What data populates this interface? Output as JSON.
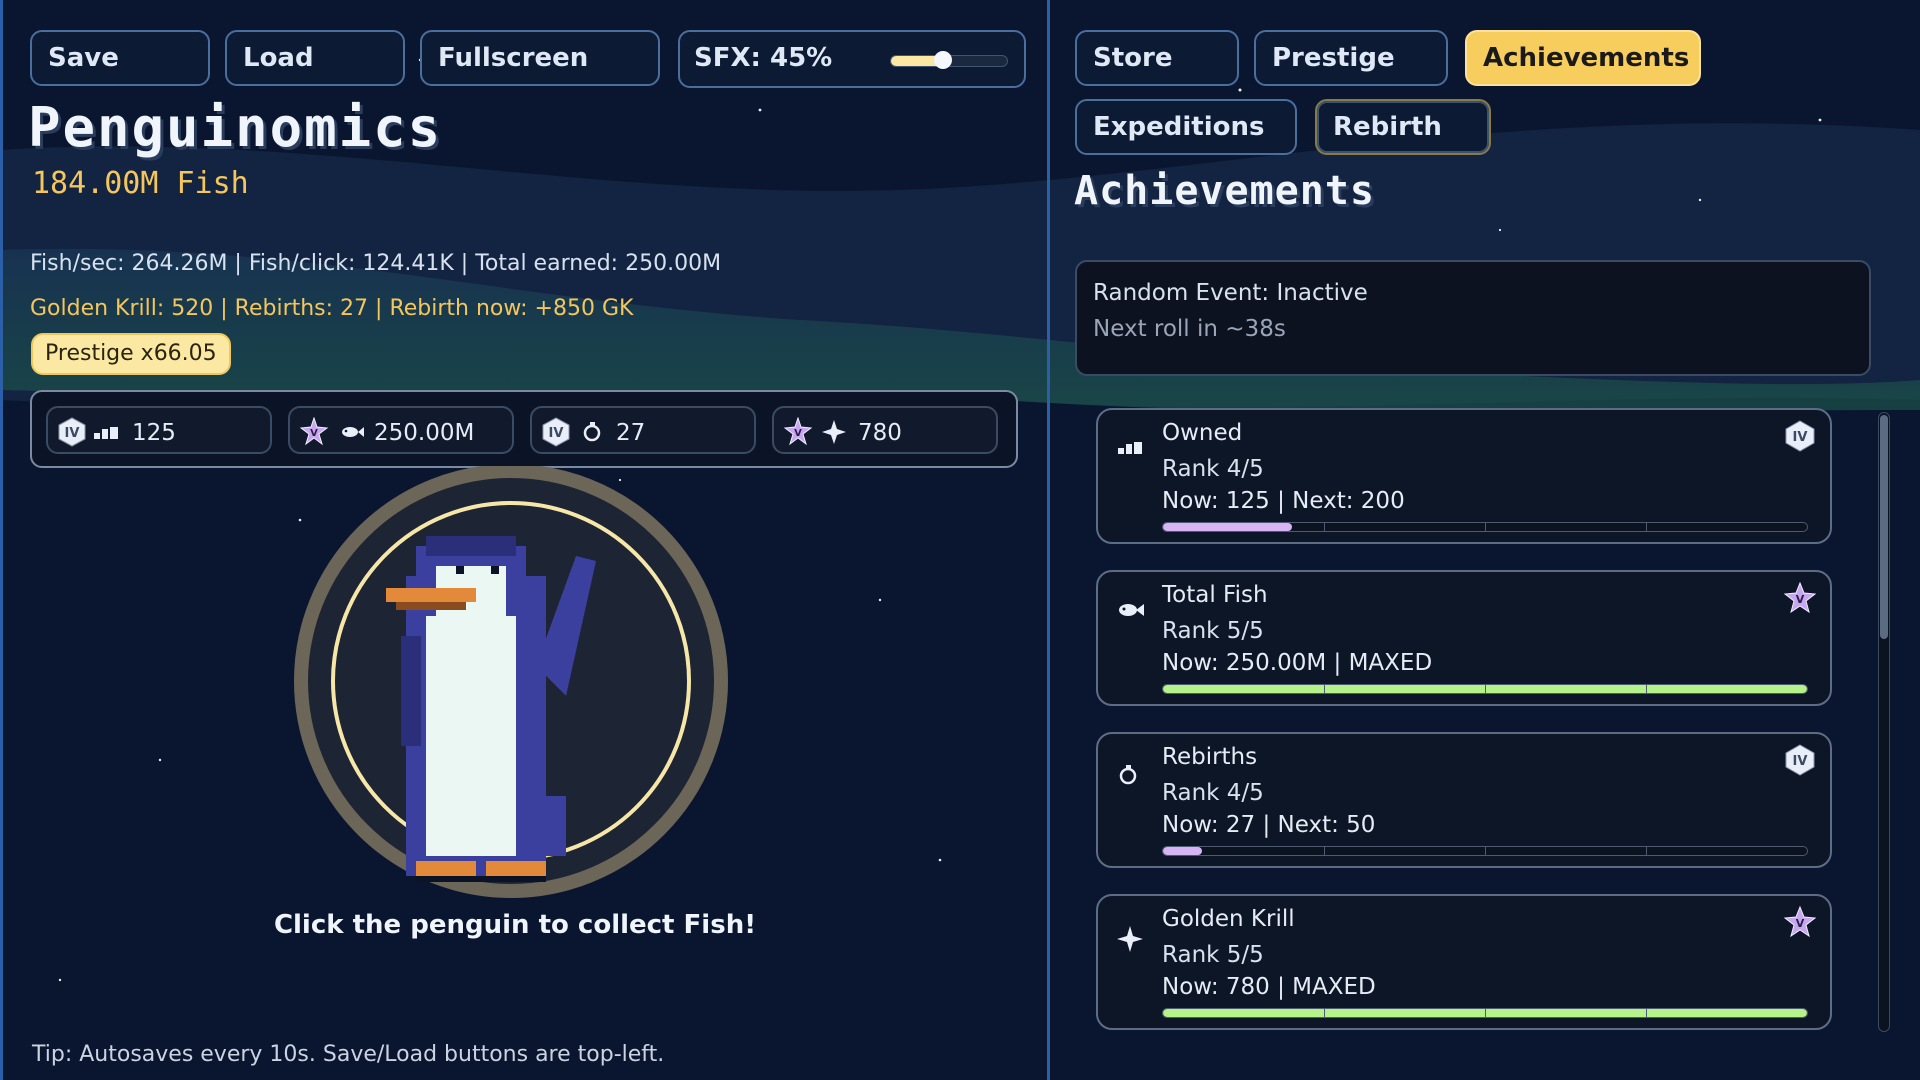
{
  "toolbar": {
    "save_label": "Save",
    "load_label": "Load",
    "fullscreen_label": "Fullscreen",
    "sfx_label": "SFX:  45%",
    "sfx_value": 0.45
  },
  "game": {
    "title": "Penguinomics",
    "fish_count": "184.00M Fish",
    "stats_line1": "Fish/sec: 264.26M  |  Fish/click: 124.41K  |  Total earned: 250.00M",
    "stats_line2": "Golden Krill: 520  |  Rebirths: 27  |  Rebirth now: +850 GK",
    "prestige_pill": "Prestige x66.05",
    "click_hint": "Click the penguin to collect Fish!",
    "tip": "Tip: Autosaves every 10s. Save/Load buttons are top-left."
  },
  "achievement_chips": [
    {
      "tier_icon": "tier-iv-badge",
      "icon": "owned-icon",
      "value": "125"
    },
    {
      "tier_icon": "tier-v-star",
      "icon": "fish-icon",
      "value": "250.00M"
    },
    {
      "tier_icon": "tier-iv-badge",
      "icon": "rebirth-icon",
      "value": "27"
    },
    {
      "tier_icon": "tier-v-star",
      "icon": "sparkle-icon",
      "value": "780"
    }
  ],
  "tabs": {
    "store": "Store",
    "prestige": "Prestige",
    "achievements": "Achievements",
    "expeditions": "Expeditions",
    "rebirth": "Rebirth",
    "active": "achievements"
  },
  "section_title": "Achievements",
  "random_event": {
    "status": "Random Event: Inactive",
    "next_roll": "Next roll in ~38s"
  },
  "achievements": [
    {
      "name": "Owned",
      "rank": "Rank 4/5",
      "progress_text": "Now: 125  |  Next: 200",
      "progress": 0.2,
      "color": "#d8b4f5",
      "icon": "owned-icon",
      "tier": "tier-iv-badge"
    },
    {
      "name": "Total Fish",
      "rank": "Rank 5/5",
      "progress_text": "Now: 250.00M  |  MAXED",
      "progress": 1.0,
      "color": "#b6f28a",
      "icon": "fish-icon",
      "tier": "tier-v-star"
    },
    {
      "name": "Rebirths",
      "rank": "Rank 4/5",
      "progress_text": "Now: 27  |  Next: 50",
      "progress": 0.06,
      "color": "#d8b4f5",
      "icon": "rebirth-icon",
      "tier": "tier-iv-badge"
    },
    {
      "name": "Golden Krill",
      "rank": "Rank 5/5",
      "progress_text": "Now: 780  |  MAXED",
      "progress": 1.0,
      "color": "#b6f28a",
      "icon": "sparkle-icon",
      "tier": "tier-v-star"
    }
  ],
  "colors": {
    "accent_gold": "#f4c65c",
    "active_tab": "#f7cd5d",
    "panel_border": "#2b5fa8"
  }
}
